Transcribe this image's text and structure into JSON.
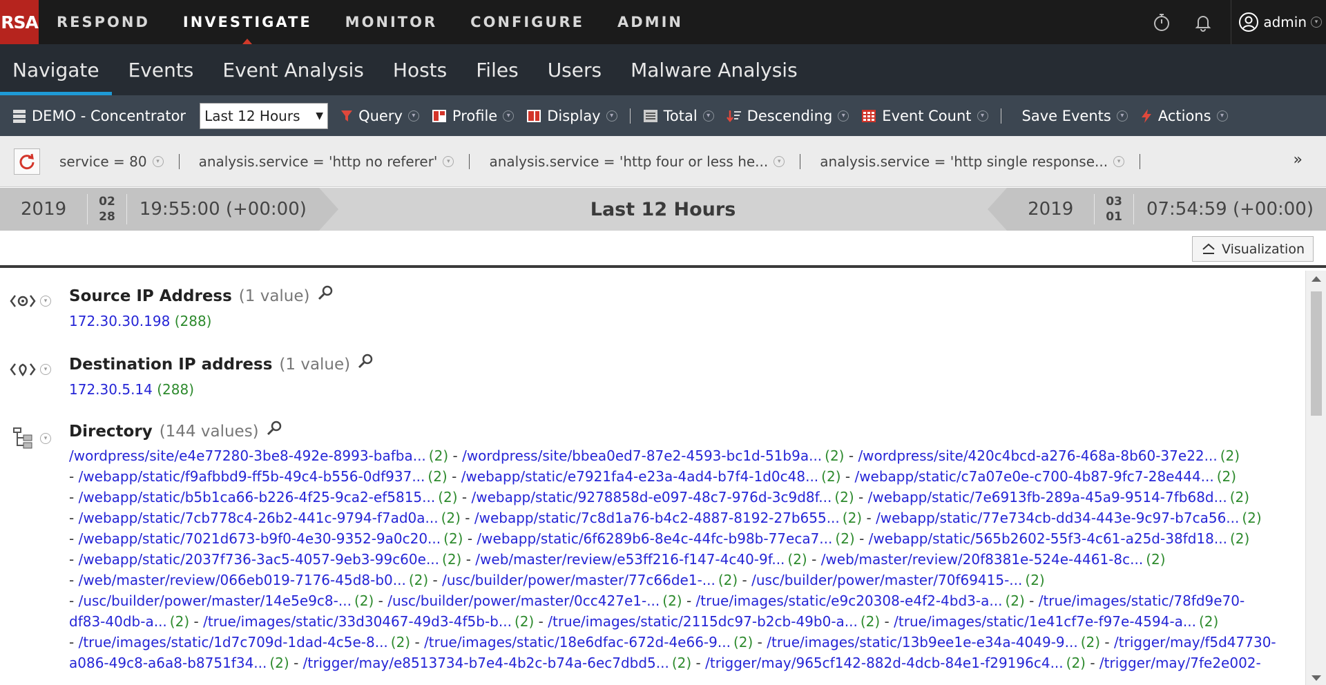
{
  "brand": {
    "logo": "RSA",
    "accent": "#b6241e",
    "highlight": "#1e9ad6"
  },
  "topnav": {
    "items": [
      "RESPOND",
      "INVESTIGATE",
      "MONITOR",
      "CONFIGURE",
      "ADMIN"
    ],
    "active": "INVESTIGATE",
    "icons": [
      "stopwatch-icon",
      "bell-icon"
    ],
    "user": "admin"
  },
  "subnav": {
    "items": [
      "Navigate",
      "Events",
      "Event Analysis",
      "Hosts",
      "Files",
      "Users",
      "Malware Analysis"
    ],
    "active": "Navigate"
  },
  "toolbar": {
    "service": "DEMO - Concentrator",
    "time_range": "Last 12 Hours",
    "query": "Query",
    "profile": "Profile",
    "display": "Display",
    "total": "Total",
    "descending": "Descending",
    "event_count": "Event Count",
    "save_events": "Save Events",
    "actions": "Actions"
  },
  "filters": [
    "service = 80",
    "analysis.service = 'http no referer'",
    "analysis.service = 'http four or less he...",
    "analysis.service = 'http single response..."
  ],
  "filters_more": "»",
  "timebar": {
    "start_year": "2019",
    "start_month": "02",
    "start_day": "28",
    "start_time": "19:55:00 (+00:00)",
    "label": "Last 12 Hours",
    "end_year": "2019",
    "end_month": "03",
    "end_day": "01",
    "end_time": "07:54:59 (+00:00)"
  },
  "visualization_label": "Visualization",
  "sections": {
    "source": {
      "title": "Source IP Address",
      "count": "(1 value)",
      "value": "172.30.30.198",
      "value_count": "(288)"
    },
    "destination": {
      "title": "Destination IP address",
      "count": "(1 value)",
      "value": "172.30.5.14",
      "value_count": "(288)"
    },
    "directory": {
      "title": "Directory",
      "count": "(144 values)",
      "lines": [
        [
          [
            "/wordpress/site/e4e77280-3be8-492e-8993-bafba...",
            "(2)"
          ],
          [
            "/wordpress/site/bbea0ed7-87e2-4593-bc1d-51b9a...",
            "(2)"
          ],
          [
            "/wordpress/site/420c4bcd-a276-468a-8b60-37e22...",
            "(2)"
          ]
        ],
        [
          [
            "/webapp/static/f9afbbd9-ff5b-49c4-b556-0df937...",
            "(2)"
          ],
          [
            "/webapp/static/e7921fa4-e23a-4ad4-b7f4-1d0c48...",
            "(2)"
          ],
          [
            "/webapp/static/c7a07e0e-c700-4b87-9fc7-28e444...",
            "(2)"
          ]
        ],
        [
          [
            "/webapp/static/b5b1ca66-b226-4f25-9ca2-ef5815...",
            "(2)"
          ],
          [
            "/webapp/static/9278858d-e097-48c7-976d-3c9d8f...",
            "(2)"
          ],
          [
            "/webapp/static/7e6913fb-289a-45a9-9514-7fb68d...",
            "(2)"
          ]
        ],
        [
          [
            "/webapp/static/7cb778c4-26b2-441c-9794-f7ad0a...",
            "(2)"
          ],
          [
            "/webapp/static/7c8d1a76-b4c2-4887-8192-27b655...",
            "(2)"
          ],
          [
            "/webapp/static/77e734cb-dd34-443e-9c97-b7ca56...",
            "(2)"
          ]
        ],
        [
          [
            "/webapp/static/7021d673-b9f0-4e30-9352-9a0c20...",
            "(2)"
          ],
          [
            "/webapp/static/6f6289b6-8e4c-44fc-b98b-77eca7...",
            "(2)"
          ],
          [
            "/webapp/static/565b2602-55f3-4c61-a25d-38fd18...",
            "(2)"
          ]
        ],
        [
          [
            "/webapp/static/2037f736-3ac5-4057-9eb3-99c60e...",
            "(2)"
          ],
          [
            "/web/master/review/e53ff216-f147-4c40-9f...",
            "(2)"
          ],
          [
            "/web/master/review/20f8381e-524e-4461-8c...",
            "(2)"
          ]
        ],
        [
          [
            "/web/master/review/066eb019-7176-45d8-b0...",
            "(2)"
          ],
          [
            "/usc/builder/power/master/77c66de1-...",
            "(2)"
          ],
          [
            "/usc/builder/power/master/70f69415-...",
            "(2)"
          ]
        ],
        [
          [
            "/usc/builder/power/master/14e5e9c8-...",
            "(2)"
          ],
          [
            "/usc/builder/power/master/0cc427e1-...",
            "(2)"
          ],
          [
            "/true/images/static/e9c20308-e4f2-4bd3-a...",
            "(2)"
          ],
          [
            "/true/images/static/78fd9e70-",
            ""
          ]
        ],
        [
          [
            "df83-40db-a...",
            "(2)"
          ],
          [
            "/true/images/static/33d30467-49d3-4f5b-b...",
            "(2)"
          ],
          [
            "/true/images/static/2115dc97-b2cb-49b0-a...",
            "(2)"
          ],
          [
            "/true/images/static/1e41cf7e-f97e-4594-a...",
            "(2)"
          ]
        ],
        [
          [
            "/true/images/static/1d7c709d-1dad-4c5e-8...",
            "(2)"
          ],
          [
            "/true/images/static/18e6dfac-672d-4e66-9...",
            "(2)"
          ],
          [
            "/true/images/static/13b9ee1e-e34a-4049-9...",
            "(2)"
          ],
          [
            "/trigger/may/f5d47730-",
            ""
          ]
        ],
        [
          [
            "a086-49c8-a6a8-b8751f34...",
            "(2)"
          ],
          [
            "/trigger/may/e8513734-b7e4-4b2c-b74a-6ec7dbd5...",
            "(2)"
          ],
          [
            "/trigger/may/965cf142-882d-4dcb-84e1-f29196c4...",
            "(2)"
          ],
          [
            "/trigger/may/7fe2e002-",
            ""
          ]
        ]
      ]
    }
  }
}
